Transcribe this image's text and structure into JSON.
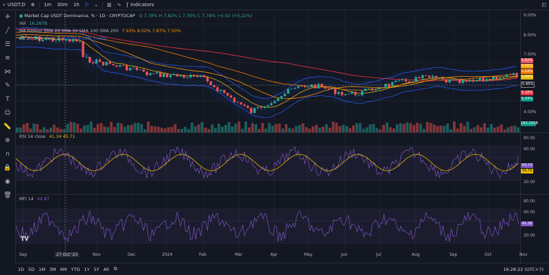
{
  "topbar": {
    "symbol": "USDT.D",
    "intervals": [
      "1m",
      "30m",
      "1h",
      "D"
    ],
    "indicators_label": "Indicators"
  },
  "chart_info": {
    "title": "Market Cap USDT Dominance, % · 1D · CRYPTOCAP",
    "ohlc": "O 7.78%  H 7.82%  L 7.76%  C 7.78%  +0.02 (+0.22%)",
    "vol_label": "Vol",
    "vol_value": "16.287B",
    "ribbon_label": "MA Ribbon SMA 20 SMA 50 SMA 100 SMA 200",
    "ribbon_values": "7.93%  8.02%  7.87%  7.50%",
    "bb_label": "BB 20 SMA close 2",
    "bb_values": "7.82%  8.20%  7.66%",
    "rsi_label": "RSI 14 close",
    "rsi_values": "41.34  45.71",
    "mfi_label": "MFI 14",
    "mfi_value": "44.87"
  },
  "price_axis": {
    "ticks": [
      "9.00%",
      "8.00%",
      "7.00%",
      "6.00%",
      "5.00%",
      "4.00%"
    ],
    "tags": [
      {
        "text": "5.82%",
        "color": "#f7525f"
      },
      {
        "text": "5.60%",
        "color": "#ff9800"
      },
      {
        "text": "5.53%",
        "color": "#f57c00"
      },
      {
        "text": "5.45%",
        "color": "#e6b800"
      },
      {
        "text": "5.45%",
        "color": "#131722"
      },
      {
        "text": "5.18%",
        "color": "#f23645"
      },
      {
        "text": "5.03%",
        "color": "#089981"
      }
    ],
    "vol_tag": "182.251B"
  },
  "rsi_axis": {
    "ticks": [
      "80.00",
      "60.00",
      "20.00"
    ],
    "tags": [
      {
        "text": "43.73",
        "color": "#7e57c2"
      },
      {
        "text": "39.76",
        "color": "#e6b800"
      }
    ]
  },
  "mfi_axis": {
    "ticks": [
      "80.00",
      "60.00",
      "20.00"
    ],
    "tags": [
      {
        "text": "41.38",
        "color": "#7e57c2"
      }
    ]
  },
  "time_axis": {
    "labels": [
      "Sep",
      "27 Oct '23",
      "Nov",
      "Dec",
      "2024",
      "Feb",
      "Mar",
      "Apr",
      "May",
      "Jun",
      "Jul",
      "Aug",
      "Sep",
      "Oct",
      "Nov"
    ]
  },
  "bottombar": {
    "ranges": [
      "1D",
      "5D",
      "1M",
      "3M",
      "6M",
      "YTD",
      "1Y",
      "5Y",
      "All"
    ],
    "clock": "16:28:22 (UTC+7)"
  }
}
